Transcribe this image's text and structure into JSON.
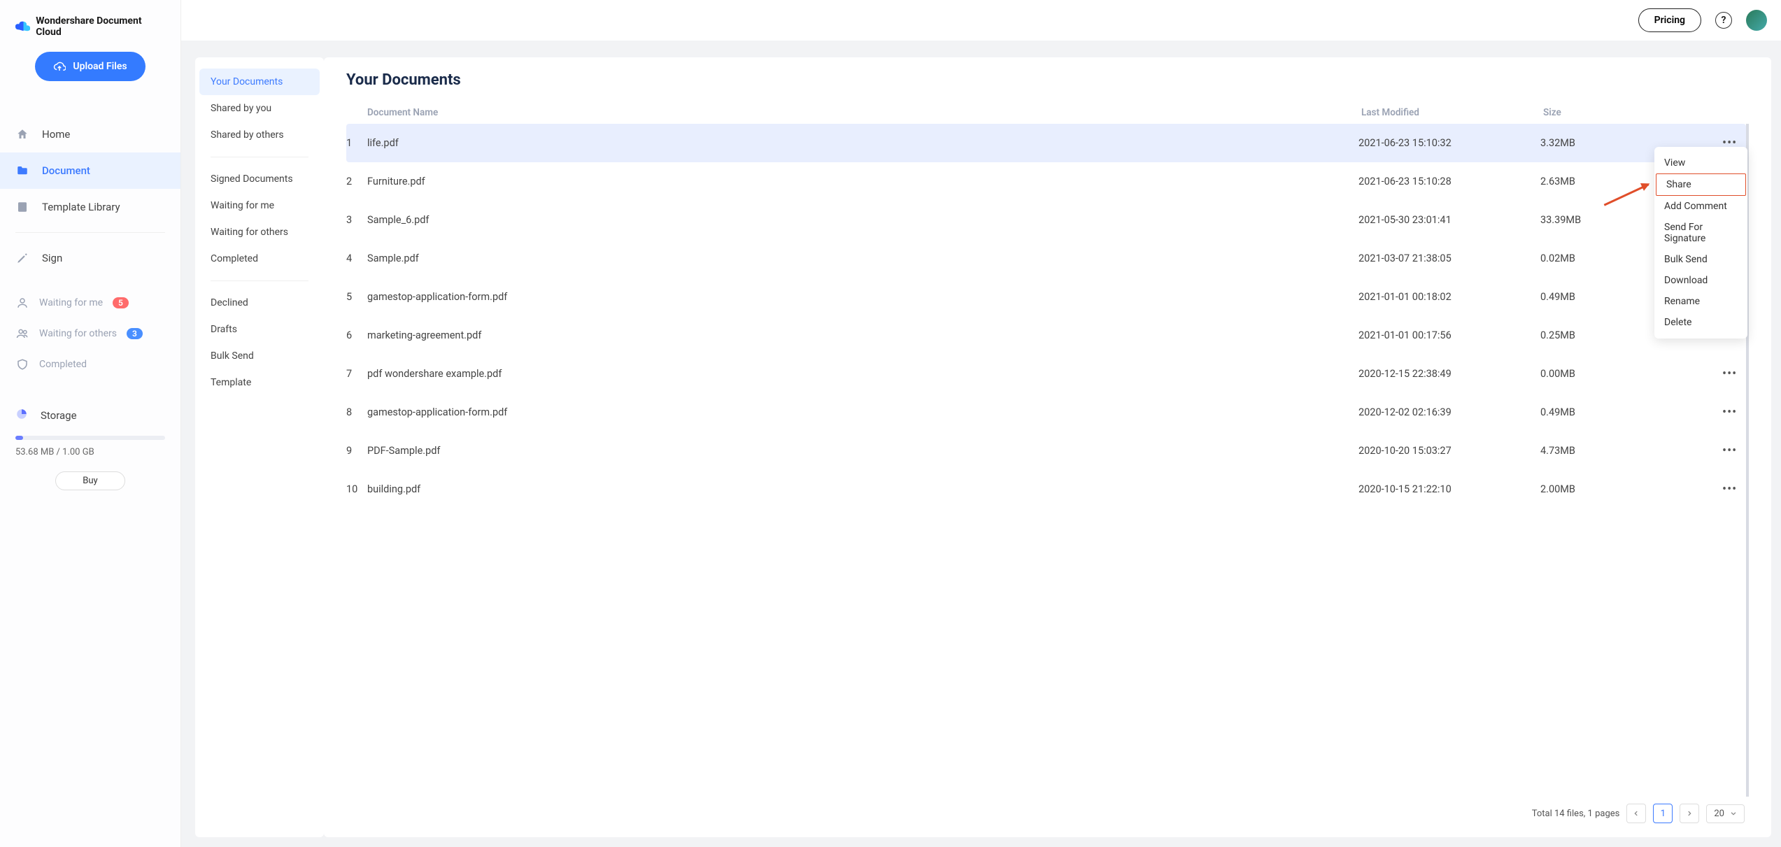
{
  "app_name": "Wondershare Document Cloud",
  "topbar": {
    "pricing_label": "Pricing"
  },
  "upload_label": "Upload Files",
  "primary_nav": {
    "home_label": "Home",
    "document_label": "Document",
    "template_label": "Template Library",
    "sign_label": "Sign",
    "waiting_me_label": "Waiting for me",
    "waiting_me_count": "5",
    "waiting_others_label": "Waiting for others",
    "waiting_others_count": "3",
    "completed_label": "Completed"
  },
  "storage": {
    "label": "Storage",
    "used_text": "53.68 MB / 1.00 GB",
    "buy_label": "Buy"
  },
  "secondary_nav": {
    "items": [
      "Your Documents",
      "Shared by you",
      "Shared by others",
      "Signed Documents",
      "Waiting for me",
      "Waiting for others",
      "Completed",
      "Declined",
      "Drafts",
      "Bulk Send",
      "Template"
    ]
  },
  "page_title": "Your Documents",
  "columns": {
    "name": "Document Name",
    "modified": "Last Modified",
    "size": "Size"
  },
  "rows": [
    {
      "idx": "1",
      "name": "life.pdf",
      "modified": "2021-06-23 15:10:32",
      "size": "3.32MB"
    },
    {
      "idx": "2",
      "name": "Furniture.pdf",
      "modified": "2021-06-23 15:10:28",
      "size": "2.63MB"
    },
    {
      "idx": "3",
      "name": "Sample_6.pdf",
      "modified": "2021-05-30 23:01:41",
      "size": "33.39MB"
    },
    {
      "idx": "4",
      "name": "Sample.pdf",
      "modified": "2021-03-07 21:38:05",
      "size": "0.02MB"
    },
    {
      "idx": "5",
      "name": "gamestop-application-form.pdf",
      "modified": "2021-01-01 00:18:02",
      "size": "0.49MB"
    },
    {
      "idx": "6",
      "name": "marketing-agreement.pdf",
      "modified": "2021-01-01 00:17:56",
      "size": "0.25MB"
    },
    {
      "idx": "7",
      "name": "pdf wondershare example.pdf",
      "modified": "2020-12-15 22:38:49",
      "size": "0.00MB"
    },
    {
      "idx": "8",
      "name": "gamestop-application-form.pdf",
      "modified": "2020-12-02 02:16:39",
      "size": "0.49MB"
    },
    {
      "idx": "9",
      "name": "PDF-Sample.pdf",
      "modified": "2020-10-20 15:03:27",
      "size": "4.73MB"
    },
    {
      "idx": "10",
      "name": "building.pdf",
      "modified": "2020-10-15 21:22:10",
      "size": "2.00MB"
    }
  ],
  "context_menu": {
    "items": [
      "View",
      "Share",
      "Add Comment",
      "Send For Signature",
      "Bulk Send",
      "Download",
      "Rename",
      "Delete"
    ],
    "highlight_index": 1
  },
  "pager": {
    "summary": "Total 14 files, 1 pages",
    "current_page": "1",
    "page_size": "20"
  }
}
